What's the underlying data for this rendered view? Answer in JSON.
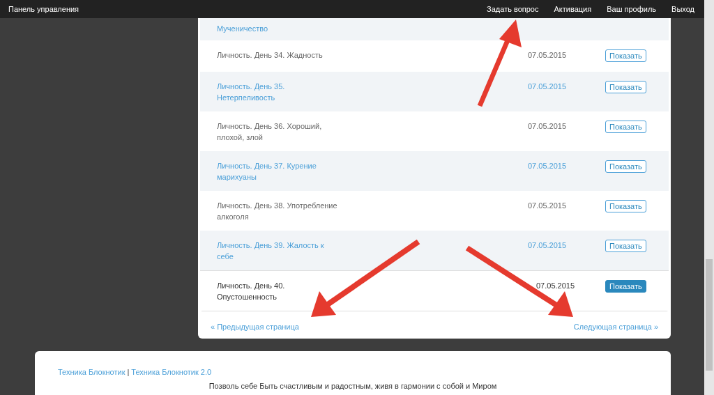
{
  "top_bar": {
    "title": "Панель управления",
    "links": [
      "Задать вопрос",
      "Активация",
      "Ваш профиль",
      "Выход"
    ]
  },
  "table": {
    "top_row": {
      "title": "Мученичество",
      "striped": true
    },
    "rows": [
      {
        "title": "Личность. День 34. Жадность",
        "date": "07.05.2015",
        "button": "Показать",
        "striped": false,
        "selected": false
      },
      {
        "title": "Личность. День 35. Нетерпеливость",
        "date": "07.05.2015",
        "button": "Показать",
        "striped": true,
        "selected": false
      },
      {
        "title": "Личность. День 36. Хороший, плохой, злой",
        "date": "07.05.2015",
        "button": "Показать",
        "striped": false,
        "selected": false
      },
      {
        "title": "Личность. День 37. Курение марихуаны",
        "date": "07.05.2015",
        "button": "Показать",
        "striped": true,
        "selected": false
      },
      {
        "title": "Личность. День 38. Употребление алкоголя",
        "date": "07.05.2015",
        "button": "Показать",
        "striped": false,
        "selected": false
      },
      {
        "title": "Личность. День 39. Жалость к себе",
        "date": "07.05.2015",
        "button": "Показать",
        "striped": true,
        "selected": false
      },
      {
        "title": "Личность. День 40. Опустошенность",
        "date": "07.05.2015",
        "button": "Показать",
        "striped": false,
        "selected": true
      }
    ]
  },
  "pagination": {
    "previous": "« Предыдущая страница",
    "next": "Следующая страница »"
  },
  "footer": {
    "links": [
      "Техника Блокнотик",
      "Техника Блокнотик 2.0"
    ],
    "separator": "|",
    "tagline": "Позволь себе Быть счастливым и радостным, живя в гармонии с собой и Миром"
  }
}
